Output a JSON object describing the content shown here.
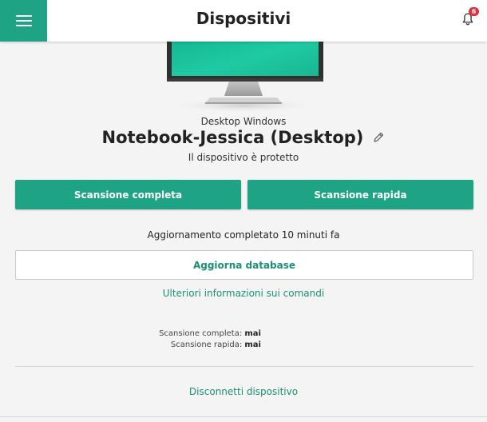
{
  "header": {
    "title": "Dispositivi",
    "notifications_count": "6",
    "menu_icon": "hamburger-menu-icon",
    "notification_icon": "bell-icon"
  },
  "device": {
    "type": "Desktop Windows",
    "name": "Notebook-Jessica (Desktop)",
    "status": "Il dispositivo è protetto",
    "illustration": "desktop-monitor-icon",
    "edit_icon": "pencil-icon"
  },
  "actions": {
    "full_scan_label": "Scansione completa",
    "quick_scan_label": "Scansione rapida",
    "update_status": "Aggiornamento completato 10 minuti fa",
    "update_db_label": "Aggiorna database",
    "commands_link": "Ulteriori informazioni sui comandi"
  },
  "scan_info": {
    "full_label": "Scansione completa:",
    "full_value": "mai",
    "quick_label": "Scansione rapida:",
    "quick_value": "mai"
  },
  "footer": {
    "disconnect_label": "Disconnetti dispositivo"
  },
  "colors": {
    "accent": "#1ea385",
    "badge": "#e0303b",
    "link": "#1a8f74",
    "background": "#f4f4f4"
  }
}
